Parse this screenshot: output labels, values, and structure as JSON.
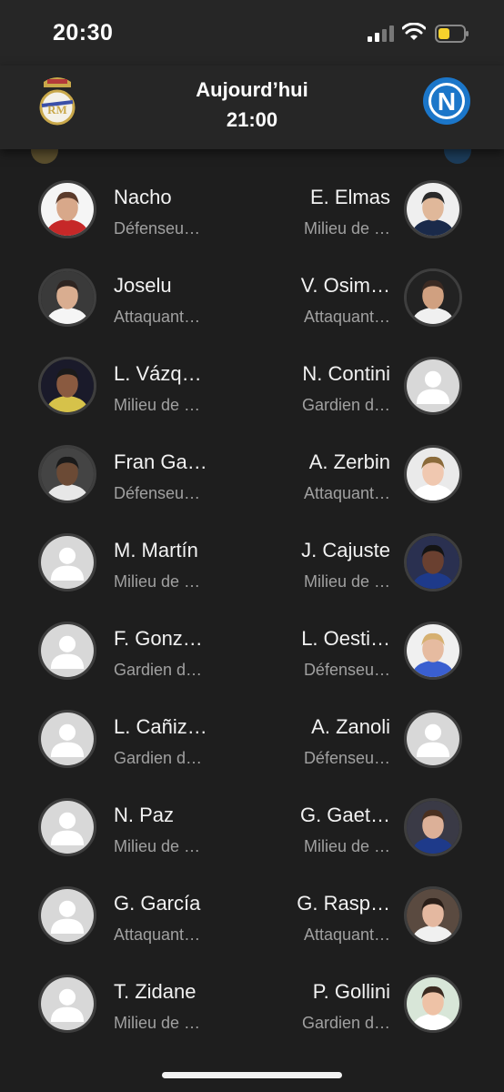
{
  "status_bar": {
    "time": "20:30"
  },
  "header": {
    "title": "Aujourd’hui",
    "kickoff": "21:00",
    "home_crest": "real-madrid-crest",
    "away_crest": "napoli-crest"
  },
  "accent": {
    "home": "#c9a84a",
    "away": "#1b76c9"
  },
  "rows": [
    {
      "left": {
        "name": "Nacho",
        "position": "Défenseu…",
        "photo": true
      },
      "right": {
        "name": "E. Elmas",
        "position": "Milieu de …",
        "photo": true
      }
    },
    {
      "left": {
        "name": "Joselu",
        "position": "Attaquant…",
        "photo": true
      },
      "right": {
        "name": "V. Osim…",
        "position": "Attaquant…",
        "photo": true
      }
    },
    {
      "left": {
        "name": "L. Vázq…",
        "position": "Milieu de …",
        "photo": true
      },
      "right": {
        "name": "N. Contini",
        "position": "Gardien d…",
        "photo": false
      }
    },
    {
      "left": {
        "name": "Fran Ga…",
        "position": "Défenseu…",
        "photo": true
      },
      "right": {
        "name": "A. Zerbin",
        "position": "Attaquant…",
        "photo": true
      }
    },
    {
      "left": {
        "name": "M. Martín",
        "position": "Milieu de …",
        "photo": false
      },
      "right": {
        "name": "J. Cajuste",
        "position": "Milieu de …",
        "photo": true
      }
    },
    {
      "left": {
        "name": "F. Gonz…",
        "position": "Gardien d…",
        "photo": false
      },
      "right": {
        "name": "L. Oesti…",
        "position": "Défenseu…",
        "photo": true
      }
    },
    {
      "left": {
        "name": "L. Cañiz…",
        "position": "Gardien d…",
        "photo": false
      },
      "right": {
        "name": "A. Zanoli",
        "position": "Défenseu…",
        "photo": false
      }
    },
    {
      "left": {
        "name": "N. Paz",
        "position": "Milieu de …",
        "photo": false
      },
      "right": {
        "name": "G. Gaet…",
        "position": "Milieu de …",
        "photo": true
      }
    },
    {
      "left": {
        "name": "G. García",
        "position": "Attaquant…",
        "photo": false
      },
      "right": {
        "name": "G. Rasp…",
        "position": "Attaquant…",
        "photo": true
      }
    },
    {
      "left": {
        "name": "T. Zidane",
        "position": "Milieu de …",
        "photo": false
      },
      "right": {
        "name": "P. Gollini",
        "position": "Gardien d…",
        "photo": true
      }
    }
  ]
}
